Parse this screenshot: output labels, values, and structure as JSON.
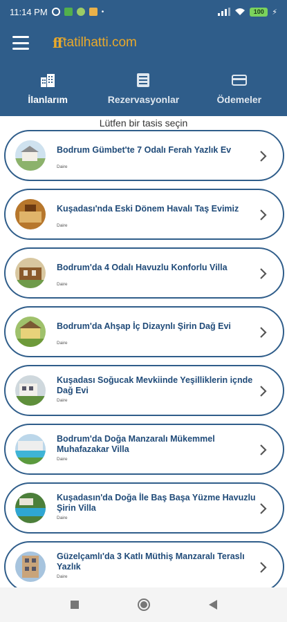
{
  "status_bar": {
    "time": "11:14 PM",
    "battery": "100"
  },
  "header": {
    "logo_text": "tatilhatti.com",
    "tabs": [
      {
        "label": "İlanlarım",
        "icon": "buildings-icon"
      },
      {
        "label": "Rezervasyonlar",
        "icon": "list-icon"
      },
      {
        "label": "Ödemeler",
        "icon": "credit-card-icon"
      }
    ]
  },
  "hint": "Lütfen bir tasis seçin",
  "listings": [
    {
      "title": "Bodrum Gümbet'te 7 Odalı Ferah Yazlık Ev",
      "type": "Daire"
    },
    {
      "title": "Kuşadası'nda Eski Dönem Havalı Taş Evimiz",
      "type": "Daire"
    },
    {
      "title": "Bodrum'da 4 Odalı Havuzlu Konforlu Villa",
      "type": "Daire"
    },
    {
      "title": "Bodrum'da Ahşap İç Dizaynlı Şirin Dağ Evi",
      "type": "Daire"
    },
    {
      "title": "Kuşadası Soğucak Mevkiinde Yeşilliklerin içnde Dağ Evi",
      "type": "Daire"
    },
    {
      "title": "Bodrum'da Doğa Manzaralı Mükemmel Muhafazakar Villa",
      "type": "Daire"
    },
    {
      "title": "Kuşadasın'da Doğa İle Baş Başa Yüzme Havuzlu Şirin Villa",
      "type": "Daire"
    },
    {
      "title": "Güzelçamlı'da 3 Katlı Müthiş Manzaralı Teraslı Yazlık",
      "type": "Daire"
    }
  ],
  "colors": {
    "primary": "#2f5d8a",
    "accent": "#e9a92b",
    "title": "#1f4a78"
  }
}
